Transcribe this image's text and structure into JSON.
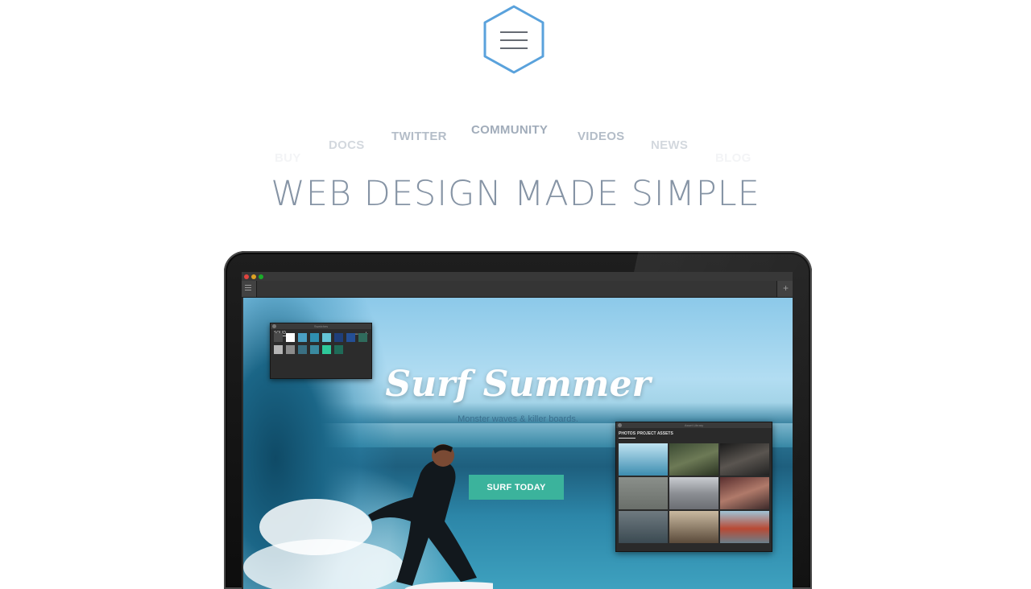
{
  "header": {
    "menu_icon": "hamburger-menu-icon",
    "hex_color": "#5aa2dc"
  },
  "nav": {
    "buy": "BUY",
    "docs": "DOCS",
    "twitter": "TWITTER",
    "community": "COMMUNITY",
    "videos": "VIDEOS",
    "news": "NEWS",
    "blog": "BLOG"
  },
  "headline": "WEB DESIGN MADE SIMPLE",
  "app": {
    "toolbar_plus": "+",
    "hero": {
      "title": "Surf Summer",
      "subtitle": "Monster waves & killer boards.",
      "cta": "SURF TODAY"
    },
    "swatches_panel": {
      "title": "Swatches",
      "tab": "SOLID",
      "minus": "−",
      "plus": "+",
      "colors_row1": [
        "#4a4a4a",
        "#ffffff",
        "#4aa0c4",
        "#2f8fb0",
        "#63c4d6",
        "#1f3f7a",
        "#244f95",
        "#2f6b5c"
      ],
      "colors_row2": [
        "#b5b5b5",
        "#8c8c8c",
        "#3a6f82",
        "#3a8aa0",
        "#2ec89a",
        "#1f6b58"
      ]
    },
    "asset_panel": {
      "title": "Asset Library",
      "tab_photos": "PHOTOS",
      "tab_project": "PROJECT ASSETS"
    }
  }
}
